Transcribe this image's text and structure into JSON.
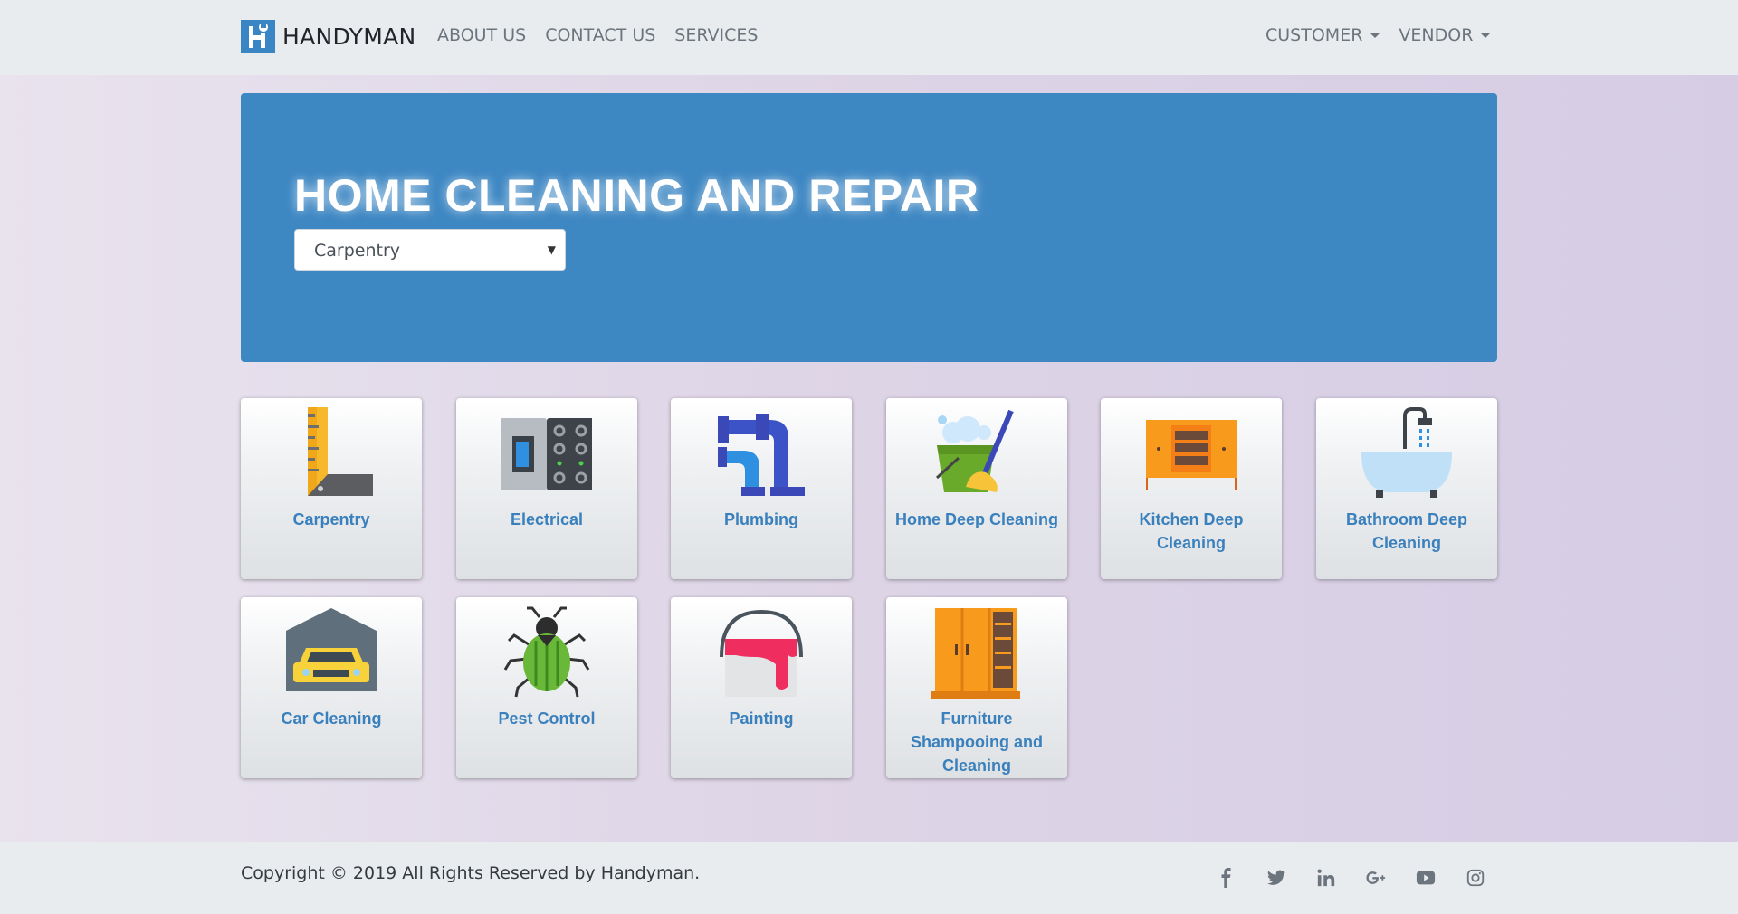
{
  "brand": {
    "name": "HANDYMAN",
    "logo_letter": "H"
  },
  "nav": {
    "links": [
      "ABOUT US",
      "CONTACT US",
      "SERVICES"
    ],
    "dropdowns": [
      "CUSTOMER",
      "VENDOR"
    ]
  },
  "hero": {
    "title": "HOME CLEANING AND REPAIR",
    "select_value": "Carpentry"
  },
  "services": [
    {
      "label": "Carpentry",
      "icon": "carpentry-ruler-icon"
    },
    {
      "label": "Electrical",
      "icon": "electrical-panel-icon"
    },
    {
      "label": "Plumbing",
      "icon": "plumbing-pipe-icon"
    },
    {
      "label": "Home Deep Cleaning",
      "icon": "bucket-broom-icon"
    },
    {
      "label": "Kitchen Deep Cleaning",
      "icon": "kitchen-cabinet-icon"
    },
    {
      "label": "Bathroom Deep Cleaning",
      "icon": "bathtub-shower-icon"
    },
    {
      "label": "Car Cleaning",
      "icon": "car-garage-icon"
    },
    {
      "label": "Pest Control",
      "icon": "beetle-icon"
    },
    {
      "label": "Painting",
      "icon": "paint-bucket-icon"
    },
    {
      "label": "Furniture Shampooing and Cleaning",
      "icon": "wardrobe-icon"
    }
  ],
  "footer": {
    "copyright": "Copyright © 2019 All Rights Reserved by Handyman.",
    "social": [
      "facebook-icon",
      "twitter-icon",
      "linkedin-icon",
      "google-plus-icon",
      "youtube-icon",
      "instagram-icon"
    ]
  },
  "colors": {
    "accent": "#3d87c3",
    "card_text": "#3a80bd",
    "nav_bg": "#e9ecef"
  }
}
